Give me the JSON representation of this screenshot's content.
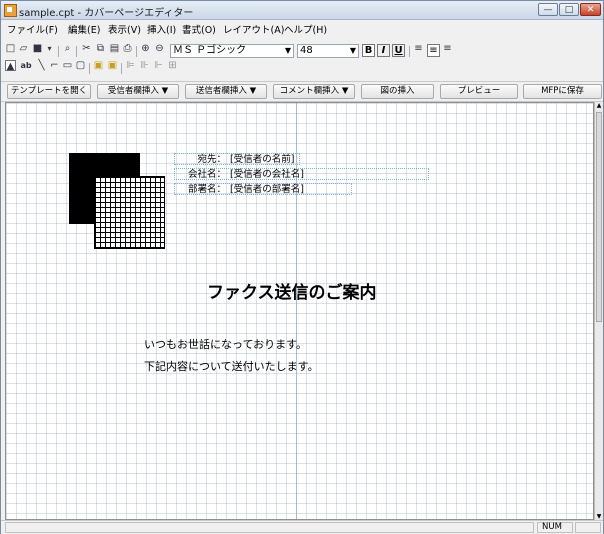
{
  "window": {
    "title": "sample.cpt - カバーページエディター",
    "min_label": "—",
    "max_label": "□",
    "close_label": "✕"
  },
  "menu": [
    {
      "label": "ファイル(F)"
    },
    {
      "label": "編集(E)"
    },
    {
      "label": "表示(V)"
    },
    {
      "label": "挿入(I)"
    },
    {
      "label": "書式(O)"
    },
    {
      "label": "レイアウト(A)"
    },
    {
      "label": "ヘルプ(H)"
    }
  ],
  "format_toolbar": {
    "font_name": "ＭＳ Ｐゴシック",
    "font_size": "48",
    "bold_label": "B",
    "italic_label": "I",
    "underline_label": "U"
  },
  "command_buttons": [
    {
      "label": "テンプレートを開く"
    },
    {
      "label": "受信者欄挿入 ▼"
    },
    {
      "label": "送信者欄挿入 ▼"
    },
    {
      "label": "コメント欄挿入 ▼"
    },
    {
      "label": "図の挿入"
    },
    {
      "label": "プレビュー"
    },
    {
      "label": "MFPに保存"
    }
  ],
  "document": {
    "fields": [
      {
        "label": "宛先：",
        "value": "[受信者の名前]"
      },
      {
        "label": "会社名：",
        "value": "[受信者の会社名]"
      },
      {
        "label": "部署名：",
        "value": "[受信者の部署名]"
      }
    ],
    "headline": "ファクス送信のご案内",
    "body": [
      "いつもお世話になっております。",
      "下記内容について送付いたします。"
    ]
  },
  "status": {
    "num": "NUM"
  },
  "colors": {
    "titlebar": "#c9d7e8",
    "grid": "#96aabe",
    "field_border": "#7fb6d0"
  }
}
